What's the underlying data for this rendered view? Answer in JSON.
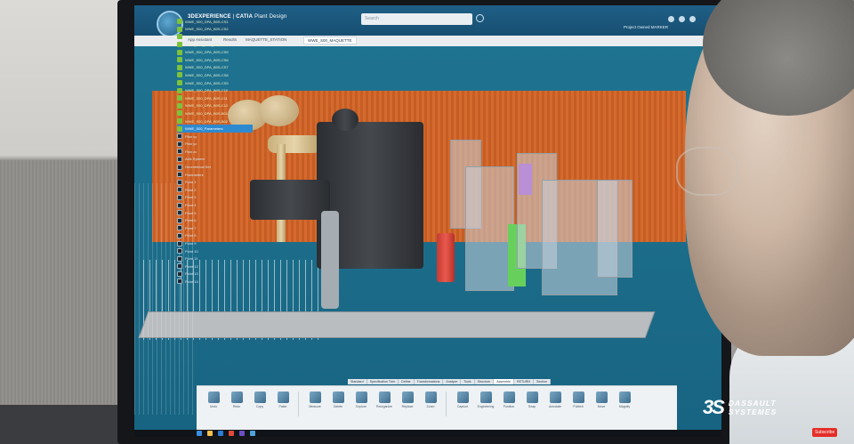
{
  "app": {
    "brand": "3DEXPERIENCE",
    "product": "CATIA",
    "role": "Plant Design",
    "search_placeholder": "Search",
    "user": "Project Owned MARKER"
  },
  "tabs": [
    {
      "label": "App Assistant"
    },
    {
      "label": "Results"
    },
    {
      "label": "MAQUETTE_STATION"
    },
    {
      "label": "WWE_S00_MAQUETTE",
      "active": true
    }
  ],
  "tree": {
    "items": [
      "WWE_S00_DPA_B0S-CS1",
      "WWE_S00_DPA_B0S-CS2",
      "WWE_S00_DPA_B0S-CS3",
      "WWE_S00_DPA_B0S-CS4",
      "WWE_S00_DPA_B0S-CS5",
      "WWE_S00_DPA_B0S-CS6",
      "WWE_S00_DPA_B0S-CS7",
      "WWE_S00_DPA_B0S-CS8",
      "WWE_S00_DPA_B0S-CS9",
      "WWE_S00_DPA_B0S-C10",
      "WWE_S00_DPA_B0S-C11",
      "WWE_S00_DPA_B0S-C12",
      "WWE_S00_DPA_B0S-B01",
      "WWE_S00_DPA_B0S-B02"
    ],
    "selected": "WWE_S00_Parameters",
    "plan_items": [
      "Plan xy",
      "Plan yz",
      "Plan zx",
      "Axis System",
      "Geometrical Set",
      "Parameters"
    ],
    "points": [
      "Point 1",
      "Point 2",
      "Point 3",
      "Point 4",
      "Point 5",
      "Point 6",
      "Point 7",
      "Point 8",
      "Point 9",
      "Point 10",
      "Point 11",
      "Point 12",
      "Point 13",
      "Point 14"
    ]
  },
  "action_bar": {
    "tabs": [
      "Standard",
      "Specification Tree",
      "Define",
      "Transformations",
      "Analyze",
      "Tools",
      "Structure",
      "Assemble",
      "RETURN",
      "Section"
    ],
    "active_tab": "Assemble",
    "buttons": [
      "Undo",
      "Redo",
      "Copy",
      "Paste",
      "Measure",
      "Delete",
      "Explore",
      "Reorganize",
      "Replace",
      "Zoom",
      "Capture",
      "Engineering",
      "Position",
      "Snap",
      "Annotate",
      "Publish",
      "Move",
      "Magnify"
    ]
  },
  "watermark": {
    "company_line1": "DASSAULT",
    "company_line2": "SYSTEMES",
    "mark": "3S",
    "subscribe": "Subscribe"
  },
  "colors": {
    "header": "#1f5f86",
    "viewport": "#1b6b88",
    "orange_wall": "#d46a2e",
    "tree_green": "#7dc23a",
    "selection": "#2d8ad0"
  },
  "icons": {
    "brand": "compass-icon",
    "search": "search-icon",
    "share": "share-icon",
    "help": "help-icon"
  }
}
